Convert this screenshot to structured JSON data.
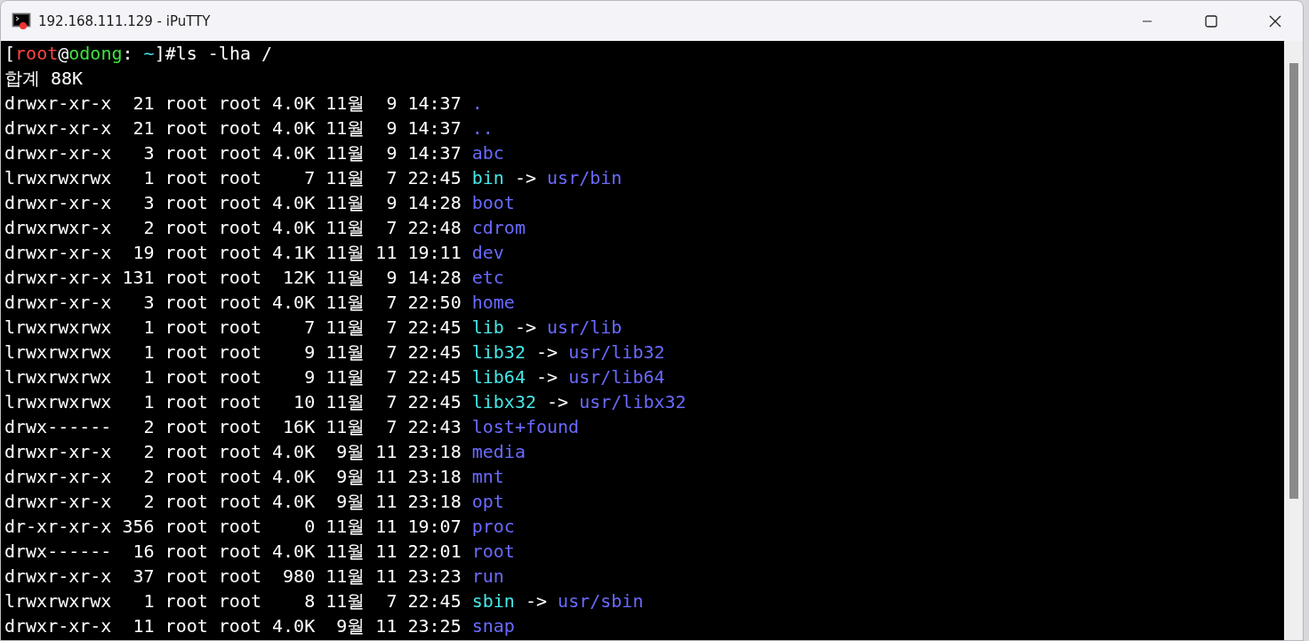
{
  "window": {
    "title": "192.168.111.129 - iPuTTY"
  },
  "prompt": [
    {
      "text": "[",
      "kind": "plain"
    },
    {
      "text": "root",
      "kind": "user"
    },
    {
      "text": "@",
      "kind": "plain"
    },
    {
      "text": "odong",
      "kind": "host"
    },
    {
      "text": ": ",
      "kind": "plain"
    },
    {
      "text": "~",
      "kind": "path"
    },
    {
      "text": "]#ls -lha /",
      "kind": "plain"
    }
  ],
  "total": "합계 88K",
  "entries": [
    {
      "info": "drwxr-xr-x  21 root root 4.0K 11월  9 14:37",
      "name": ".",
      "kind": "dir"
    },
    {
      "info": "drwxr-xr-x  21 root root 4.0K 11월  9 14:37",
      "name": "..",
      "kind": "dir"
    },
    {
      "info": "drwxr-xr-x   3 root root 4.0K 11월  9 14:37",
      "name": "abc",
      "kind": "dir"
    },
    {
      "info": "lrwxrwxrwx   1 root root    7 11월  7 22:45",
      "name": "bin",
      "kind": "link",
      "arrow": "->",
      "target": "usr/bin"
    },
    {
      "info": "drwxr-xr-x   3 root root 4.0K 11월  9 14:28",
      "name": "boot",
      "kind": "dir"
    },
    {
      "info": "drwxrwxr-x   2 root root 4.0K 11월  7 22:48",
      "name": "cdrom",
      "kind": "dir"
    },
    {
      "info": "drwxr-xr-x  19 root root 4.1K 11월 11 19:11",
      "name": "dev",
      "kind": "dir"
    },
    {
      "info": "drwxr-xr-x 131 root root  12K 11월  9 14:28",
      "name": "etc",
      "kind": "dir"
    },
    {
      "info": "drwxr-xr-x   3 root root 4.0K 11월  7 22:50",
      "name": "home",
      "kind": "dir"
    },
    {
      "info": "lrwxrwxrwx   1 root root    7 11월  7 22:45",
      "name": "lib",
      "kind": "link",
      "arrow": "->",
      "target": "usr/lib"
    },
    {
      "info": "lrwxrwxrwx   1 root root    9 11월  7 22:45",
      "name": "lib32",
      "kind": "link",
      "arrow": "->",
      "target": "usr/lib32"
    },
    {
      "info": "lrwxrwxrwx   1 root root    9 11월  7 22:45",
      "name": "lib64",
      "kind": "link",
      "arrow": "->",
      "target": "usr/lib64"
    },
    {
      "info": "lrwxrwxrwx   1 root root   10 11월  7 22:45",
      "name": "libx32",
      "kind": "link",
      "arrow": "->",
      "target": "usr/libx32"
    },
    {
      "info": "drwx------   2 root root  16K 11월  7 22:43",
      "name": "lost+found",
      "kind": "dir"
    },
    {
      "info": "drwxr-xr-x   2 root root 4.0K  9월 11 23:18",
      "name": "media",
      "kind": "dir"
    },
    {
      "info": "drwxr-xr-x   2 root root 4.0K  9월 11 23:18",
      "name": "mnt",
      "kind": "dir"
    },
    {
      "info": "drwxr-xr-x   2 root root 4.0K  9월 11 23:18",
      "name": "opt",
      "kind": "dir"
    },
    {
      "info": "dr-xr-xr-x 356 root root    0 11월 11 19:07",
      "name": "proc",
      "kind": "dir"
    },
    {
      "info": "drwx------  16 root root 4.0K 11월 11 22:01",
      "name": "root",
      "kind": "dir"
    },
    {
      "info": "drwxr-xr-x  37 root root  980 11월 11 23:23",
      "name": "run",
      "kind": "dir"
    },
    {
      "info": "lrwxrwxrwx   1 root root    8 11월  7 22:45",
      "name": "sbin",
      "kind": "link",
      "arrow": "->",
      "target": "usr/sbin"
    },
    {
      "info": "drwxr-xr-x  11 root root 4.0K  9월 11 23:25",
      "name": "snap",
      "kind": "dir"
    }
  ]
}
